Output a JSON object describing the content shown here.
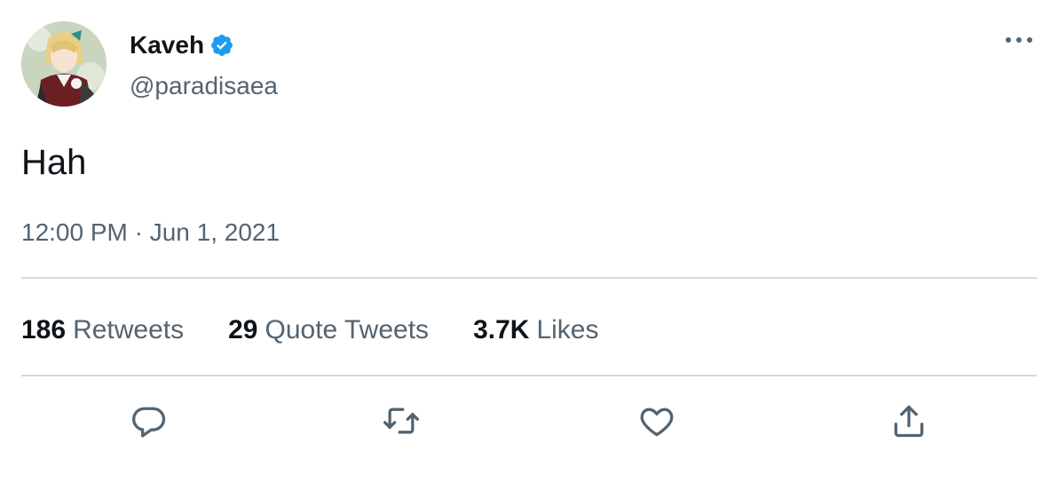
{
  "tweet": {
    "author": {
      "display_name": "Kaveh",
      "handle": "@paradisaea",
      "verified": true,
      "avatar_icon": "avatar-icon"
    },
    "text": "Hah",
    "timestamp": "12:00 PM · Jun 1, 2021",
    "stats": {
      "retweets_count": "186",
      "retweets_label": "Retweets",
      "quotes_count": "29",
      "quotes_label": "Quote Tweets",
      "likes_count": "3.7K",
      "likes_label": "Likes"
    },
    "actions": [
      "reply-icon",
      "retweet-icon",
      "like-icon",
      "share-icon"
    ]
  },
  "colors": {
    "primary_text": "#0f1419",
    "secondary_text": "#536471",
    "divider": "#cfd9de",
    "verified_blue": "#1d9bf0"
  }
}
